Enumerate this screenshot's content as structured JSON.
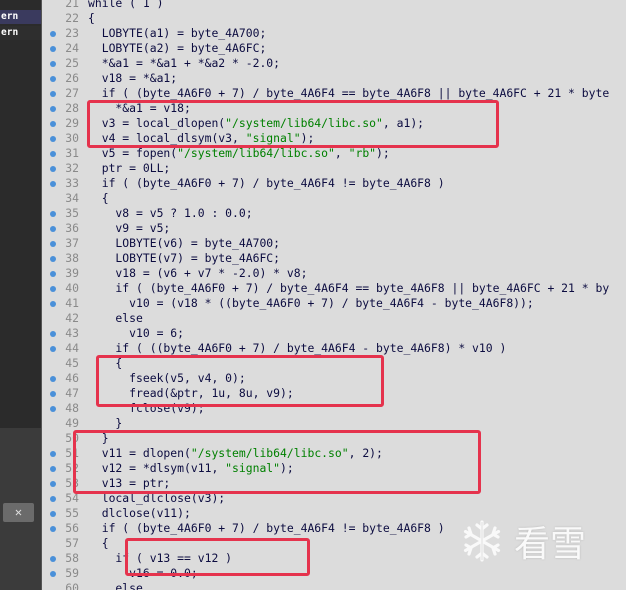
{
  "left_panel": {
    "items": [
      "ern",
      "ern"
    ],
    "close_label": "✕"
  },
  "code_lines": [
    {
      "n": "21",
      "t": "while ( 1 )",
      "bp": false
    },
    {
      "n": "22",
      "t": "{",
      "bp": false
    },
    {
      "n": "23",
      "t": "  LOBYTE(a1) = byte_4A700;",
      "bp": true
    },
    {
      "n": "24",
      "t": "  LOBYTE(a2) = byte_4A6FC;",
      "bp": true
    },
    {
      "n": "25",
      "t": "  *&a1 = *&a1 + *&a2 * -2.0;",
      "bp": true
    },
    {
      "n": "26",
      "t": "  v18 = *&a1;",
      "bp": true
    },
    {
      "n": "27",
      "t": "  if ( (byte_4A6F0 + 7) / byte_4A6F4 == byte_4A6F8 || byte_4A6FC + 21 * byte",
      "bp": true
    },
    {
      "n": "28",
      "t": "    *&a1 = v18;",
      "bp": true
    },
    {
      "n": "29",
      "t": "  v3 = local_dlopen(\"/system/lib64/libc.so\", a1);",
      "bp": true
    },
    {
      "n": "30",
      "t": "  v4 = local_dlsym(v3, \"signal\");",
      "bp": true
    },
    {
      "n": "31",
      "t": "  v5 = fopen(\"/system/lib64/libc.so\", \"rb\");",
      "bp": true
    },
    {
      "n": "32",
      "t": "  ptr = 0LL;",
      "bp": true
    },
    {
      "n": "33",
      "t": "  if ( (byte_4A6F0 + 7) / byte_4A6F4 != byte_4A6F8 )",
      "bp": true
    },
    {
      "n": "34",
      "t": "  {",
      "bp": false
    },
    {
      "n": "35",
      "t": "    v8 = v5 ? 1.0 : 0.0;",
      "bp": true
    },
    {
      "n": "36",
      "t": "    v9 = v5;",
      "bp": true
    },
    {
      "n": "37",
      "t": "    LOBYTE(v6) = byte_4A700;",
      "bp": true
    },
    {
      "n": "38",
      "t": "    LOBYTE(v7) = byte_4A6FC;",
      "bp": true
    },
    {
      "n": "39",
      "t": "    v18 = (v6 + v7 * -2.0) * v8;",
      "bp": true
    },
    {
      "n": "40",
      "t": "    if ( (byte_4A6F0 + 7) / byte_4A6F4 == byte_4A6F8 || byte_4A6FC + 21 * by",
      "bp": true
    },
    {
      "n": "41",
      "t": "      v10 = (v18 * ((byte_4A6F0 + 7) / byte_4A6F4 - byte_4A6F8));",
      "bp": true
    },
    {
      "n": "42",
      "t": "    else",
      "bp": false
    },
    {
      "n": "43",
      "t": "      v10 = 6;",
      "bp": true
    },
    {
      "n": "44",
      "t": "    if ( ((byte_4A6F0 + 7) / byte_4A6F4 - byte_4A6F8) * v10 )",
      "bp": true
    },
    {
      "n": "45",
      "t": "    {",
      "bp": false
    },
    {
      "n": "46",
      "t": "      fseek(v5, v4, 0);",
      "bp": true
    },
    {
      "n": "47",
      "t": "      fread(&ptr, 1u, 8u, v9);",
      "bp": true
    },
    {
      "n": "48",
      "t": "      fclose(v9);",
      "bp": true
    },
    {
      "n": "49",
      "t": "    }",
      "bp": false
    },
    {
      "n": "50",
      "t": "  }",
      "bp": false
    },
    {
      "n": "51",
      "t": "  v11 = dlopen(\"/system/lib64/libc.so\", 2);",
      "bp": true
    },
    {
      "n": "52",
      "t": "  v12 = *dlsym(v11, \"signal\");",
      "bp": true
    },
    {
      "n": "53",
      "t": "  v13 = ptr;",
      "bp": true
    },
    {
      "n": "54",
      "t": "  local_dlclose(v3);",
      "bp": true
    },
    {
      "n": "55",
      "t": "  dlclose(v11);",
      "bp": true
    },
    {
      "n": "56",
      "t": "  if ( (byte_4A6F0 + 7) / byte_4A6F4 != byte_4A6F8 )",
      "bp": true
    },
    {
      "n": "57",
      "t": "  {",
      "bp": false
    },
    {
      "n": "58",
      "t": "    if ( v13 == v12 )",
      "bp": true
    },
    {
      "n": "59",
      "t": "      v16 = 0.0;",
      "bp": true
    },
    {
      "n": "60",
      "t": "    else",
      "bp": false
    }
  ],
  "watermark": {
    "text": "看雪",
    "icon": "snowflake-icon"
  },
  "colors": {
    "highlight_box": "#e5334d",
    "string": "#008000",
    "keyword": "#000080",
    "breakpoint_dot": "#4a90d9"
  }
}
